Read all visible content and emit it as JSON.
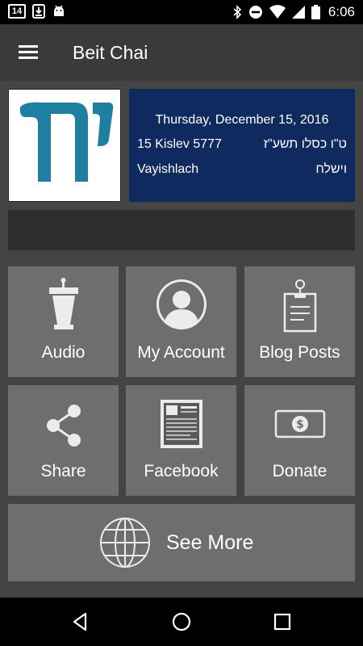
{
  "status_bar": {
    "calendar_badge": "14",
    "icons_left": [
      "calendar-icon",
      "download-icon",
      "android-icon"
    ],
    "icons_right": [
      "bluetooth-icon",
      "do-not-disturb-icon",
      "wifi-icon",
      "signal-icon",
      "battery-icon"
    ],
    "time": "6:06"
  },
  "app_bar": {
    "menu_icon": "hamburger-menu-icon",
    "title": "Beit Chai"
  },
  "header": {
    "logo_icon": "chai-hebrew-logo",
    "logo_text": "חי",
    "gregorian_date": "Thursday, December 15, 2016",
    "hebrew_date_en": "15 Kislev 5777",
    "hebrew_date_he": "ט\"ו כסלו תשע\"ז",
    "parsha_en": "Vayishlach",
    "parsha_he": "וישלח",
    "date_box_color": "#0f2a5e"
  },
  "tiles": [
    {
      "label": "Audio",
      "icon": "podium-icon"
    },
    {
      "label": "My Account",
      "icon": "person-icon"
    },
    {
      "label": "Blog Posts",
      "icon": "clipboard-icon"
    },
    {
      "label": "Share",
      "icon": "share-icon"
    },
    {
      "label": "Facebook",
      "icon": "newspaper-icon"
    },
    {
      "label": "Donate",
      "icon": "dollar-bill-icon"
    }
  ],
  "see_more": {
    "label": "See More",
    "icon": "globe-icon"
  },
  "nav_bar": {
    "icons": [
      "back-icon",
      "home-icon",
      "recents-icon"
    ]
  }
}
